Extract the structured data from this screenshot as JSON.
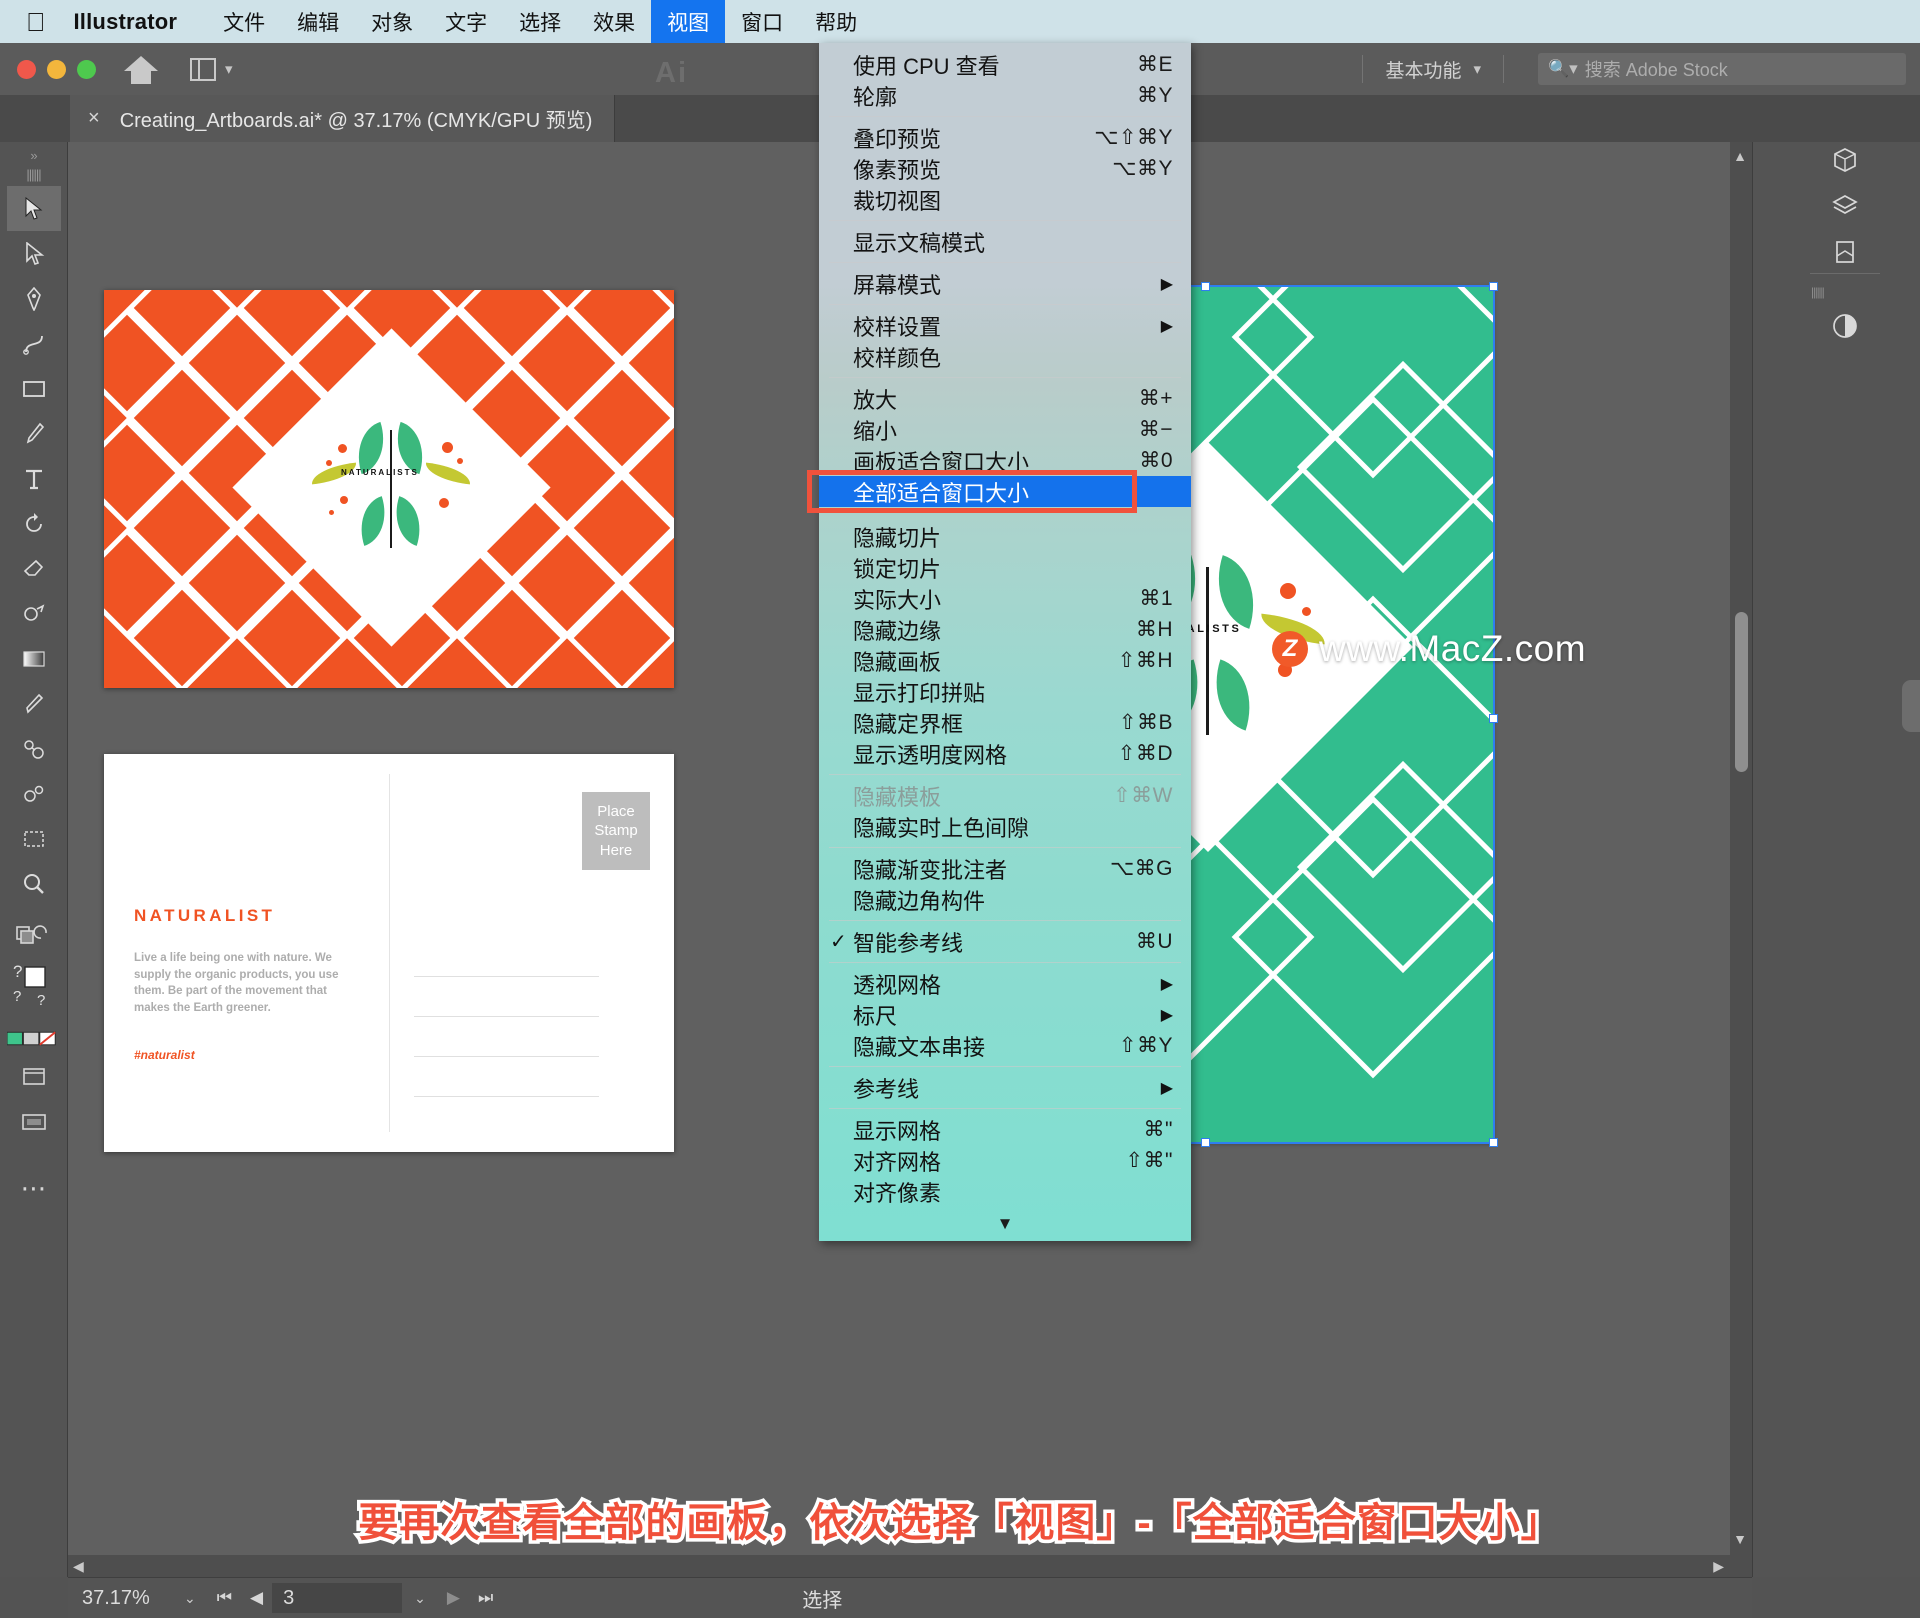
{
  "macbar": {
    "apple_icon": "apple-logo",
    "app_name": "Illustrator",
    "items": [
      {
        "label": "文件",
        "active": false
      },
      {
        "label": "编辑",
        "active": false
      },
      {
        "label": "对象",
        "active": false
      },
      {
        "label": "文字",
        "active": false
      },
      {
        "label": "选择",
        "active": false
      },
      {
        "label": "效果",
        "active": false
      },
      {
        "label": "视图",
        "active": true
      },
      {
        "label": "窗口",
        "active": false
      },
      {
        "label": "帮助",
        "active": false
      }
    ]
  },
  "titlebar": {
    "ai_ghost": "Ai",
    "workspace": "基本功能",
    "workspace_chevron": "⌄",
    "search_placeholder": "搜索 Adobe Stock",
    "search_icon": "search-icon",
    "home_icon": "home-icon",
    "layout_icon": "layout-switch-icon"
  },
  "tab": {
    "close_icon": "×",
    "title": "Creating_Artboards.ai* @ 37.17% (CMYK/GPU 预览)"
  },
  "toolbar": {
    "tools": [
      "selection-tool",
      "direct-selection-tool",
      "pen-tool",
      "curvature-tool",
      "rectangle-tool",
      "paintbrush-tool",
      "type-tool",
      "rotate-tool",
      "eraser-tool",
      "shape-builder-tool",
      "gradient-tool",
      "eyedropper-tool",
      "blend-tool",
      "symbol-sprayer-tool",
      "artboard-tool",
      "zoom-tool"
    ],
    "fill_stroke": "fill-stroke-swatch",
    "color_modes": "color-mode-swatches",
    "screen_mode": "screen-mode-icon",
    "more": "⋯"
  },
  "menu": {
    "groups": [
      {
        "items": [
          {
            "label": "使用 CPU 查看",
            "shortcut": "⌘E",
            "disabled": false,
            "submenu": false,
            "checked": false
          },
          {
            "label": "轮廓",
            "shortcut": "⌘Y",
            "disabled": false,
            "submenu": false,
            "checked": false
          }
        ]
      },
      {
        "items": [
          {
            "label": "叠印预览",
            "shortcut": "⌥⇧⌘Y",
            "disabled": false,
            "submenu": false,
            "checked": false
          },
          {
            "label": "像素预览",
            "shortcut": "⌥⌘Y",
            "disabled": false,
            "submenu": false,
            "checked": false
          },
          {
            "label": "裁切视图",
            "shortcut": "",
            "disabled": false,
            "submenu": false,
            "checked": false
          }
        ]
      },
      {
        "items": [
          {
            "label": "显示文稿模式",
            "shortcut": "",
            "disabled": false,
            "submenu": false,
            "checked": false
          }
        ]
      },
      {
        "items": [
          {
            "label": "屏幕模式",
            "shortcut": "",
            "disabled": false,
            "submenu": true,
            "checked": false
          }
        ]
      },
      {
        "items": [
          {
            "label": "校样设置",
            "shortcut": "",
            "disabled": false,
            "submenu": true,
            "checked": false
          },
          {
            "label": "校样颜色",
            "shortcut": "",
            "disabled": false,
            "submenu": false,
            "checked": false
          }
        ]
      },
      {
        "items": [
          {
            "label": "放大",
            "shortcut": "⌘+",
            "disabled": false,
            "submenu": false,
            "checked": false
          },
          {
            "label": "缩小",
            "shortcut": "⌘−",
            "disabled": false,
            "submenu": false,
            "checked": false
          },
          {
            "label": "画板适合窗口大小",
            "shortcut": "⌘0",
            "disabled": false,
            "submenu": false,
            "checked": false
          }
        ]
      },
      {
        "highlighted": {
          "label": "全部适合窗口大小",
          "shortcut": "",
          "disabled": false,
          "submenu": false,
          "checked": false
        }
      },
      {
        "items": [
          {
            "label": "隐藏切片",
            "shortcut": "",
            "disabled": false,
            "submenu": false,
            "checked": false
          },
          {
            "label": "锁定切片",
            "shortcut": "",
            "disabled": false,
            "submenu": false,
            "checked": false
          },
          {
            "label": "实际大小",
            "shortcut": "⌘1",
            "disabled": false,
            "submenu": false,
            "checked": false
          },
          {
            "label": "隐藏边缘",
            "shortcut": "⌘H",
            "disabled": false,
            "submenu": false,
            "checked": false
          },
          {
            "label": "隐藏画板",
            "shortcut": "⇧⌘H",
            "disabled": false,
            "submenu": false,
            "checked": false
          },
          {
            "label": "显示打印拼贴",
            "shortcut": "",
            "disabled": false,
            "submenu": false,
            "checked": false
          },
          {
            "label": "隐藏定界框",
            "shortcut": "⇧⌘B",
            "disabled": false,
            "submenu": false,
            "checked": false
          },
          {
            "label": "显示透明度网格",
            "shortcut": "⇧⌘D",
            "disabled": false,
            "submenu": false,
            "checked": false
          }
        ]
      },
      {
        "items": [
          {
            "label": "隐藏模板",
            "shortcut": "⇧⌘W",
            "disabled": true,
            "submenu": false,
            "checked": false
          },
          {
            "label": "隐藏实时上色间隙",
            "shortcut": "",
            "disabled": false,
            "submenu": false,
            "checked": false
          }
        ]
      },
      {
        "items": [
          {
            "label": "隐藏渐变批注者",
            "shortcut": "⌥⌘G",
            "disabled": false,
            "submenu": false,
            "checked": false
          },
          {
            "label": "隐藏边角构件",
            "shortcut": "",
            "disabled": false,
            "submenu": false,
            "checked": false
          }
        ]
      },
      {
        "items": [
          {
            "label": "智能参考线",
            "shortcut": "⌘U",
            "disabled": false,
            "submenu": false,
            "checked": true
          }
        ]
      },
      {
        "items": [
          {
            "label": "透视网格",
            "shortcut": "",
            "disabled": false,
            "submenu": true,
            "checked": false
          },
          {
            "label": "标尺",
            "shortcut": "",
            "disabled": false,
            "submenu": true,
            "checked": false
          },
          {
            "label": "隐藏文本串接",
            "shortcut": "⇧⌘Y",
            "disabled": false,
            "submenu": false,
            "checked": false
          }
        ]
      },
      {
        "items": [
          {
            "label": "参考线",
            "shortcut": "",
            "disabled": false,
            "submenu": true,
            "checked": false
          }
        ]
      },
      {
        "items": [
          {
            "label": "显示网格",
            "shortcut": "⌘\"",
            "disabled": false,
            "submenu": false,
            "checked": false
          },
          {
            "label": "对齐网格",
            "shortcut": "⇧⌘\"",
            "disabled": false,
            "submenu": false,
            "checked": false
          },
          {
            "label": "对齐像素",
            "shortcut": "",
            "disabled": false,
            "submenu": false,
            "checked": false
          }
        ]
      }
    ],
    "scroll_arrow": "▼"
  },
  "artboard1": {
    "emblem_label": "NATURALISTS",
    "background": "#f05323"
  },
  "artboard2": {
    "title": "NATURALIST",
    "body": "Live a life being one with nature. We supply the organic products, you use them. Be part of the movement that makes the Earth greener.",
    "tag": "#naturalist",
    "stamp_lines": [
      "Place",
      "Stamp",
      "Here"
    ]
  },
  "artboard3": {
    "emblem_label": "NATURALISTS",
    "background": "#32bd8e"
  },
  "watermark": {
    "badge": "Z",
    "text": "www.MacZ.com"
  },
  "caption": {
    "text": "要再次查看全部的画板，依次选择「视图」-「全部适合窗口大小」"
  },
  "statusbar": {
    "zoom": "37.17%",
    "zoom_chevron": "⌄",
    "first_icon": "first-artboard-icon",
    "prev_icon": "prev-artboard-icon",
    "page": "3",
    "page_chevron": "⌄",
    "next_icon": "next-artboard-icon",
    "last_icon": "last-artboard-icon",
    "mode": "选择"
  },
  "rightpanel": {
    "collapse_icon": "«",
    "icons": [
      "3d-panel-icon",
      "layers-panel-icon",
      "artboards-panel-icon",
      "appearance-panel-icon"
    ]
  },
  "colors": {
    "menu_top": "#c2cdd4",
    "menu_bottom": "#7fdfd2",
    "highlight_blue": "#1472ec",
    "red_box": "#f0523c",
    "orange": "#f05323",
    "green": "#32bd8e",
    "caption_red": "#f0503a"
  }
}
